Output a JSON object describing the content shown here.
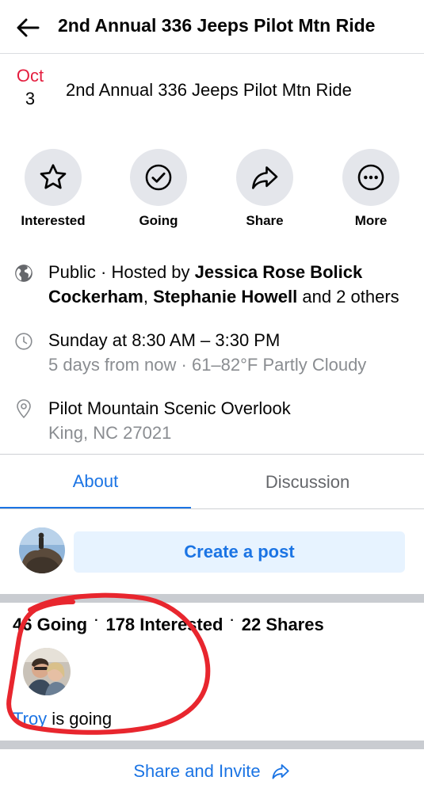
{
  "header": {
    "title": "2nd Annual 336 Jeeps Pilot Mtn Ride",
    "back_icon": "arrow-left-icon"
  },
  "event": {
    "month": "Oct",
    "day": "3",
    "title": "2nd Annual 336 Jeeps Pilot Mtn Ride"
  },
  "actions": [
    {
      "label": "Interested",
      "icon": "star-icon"
    },
    {
      "label": "Going",
      "icon": "check-circle-icon"
    },
    {
      "label": "Share",
      "icon": "share-arrow-icon"
    },
    {
      "label": "More",
      "icon": "more-dots-icon"
    }
  ],
  "details": {
    "privacy": {
      "prefix": "Public · Hosted by ",
      "host1": "Jessica Rose Bolick Cockerham",
      "sep": ", ",
      "host2": "Stephanie Howell",
      "suffix": " and 2 others"
    },
    "time": {
      "main": "Sunday at 8:30 AM – 3:30 PM",
      "sub": "5 days from now · 61–82°F Partly Cloudy"
    },
    "location": {
      "main": "Pilot Mountain Scenic Overlook",
      "sub": "King, NC 27021"
    }
  },
  "tabs": [
    {
      "label": "About",
      "active": true
    },
    {
      "label": "Discussion",
      "active": false
    }
  ],
  "composer": {
    "button_label": "Create a post"
  },
  "stats": {
    "going": "46 Going",
    "dot": "·",
    "interested": "178 Interested",
    "shares": "22 Shares"
  },
  "friend_going": {
    "name": "Troy",
    "text": " is going"
  },
  "share_invite": {
    "label": "Share and Invite"
  },
  "colors": {
    "accent": "#1b74e4",
    "date_red": "#e41e3f",
    "muted": "#8a8d91",
    "annotation_red": "#e8262e"
  }
}
